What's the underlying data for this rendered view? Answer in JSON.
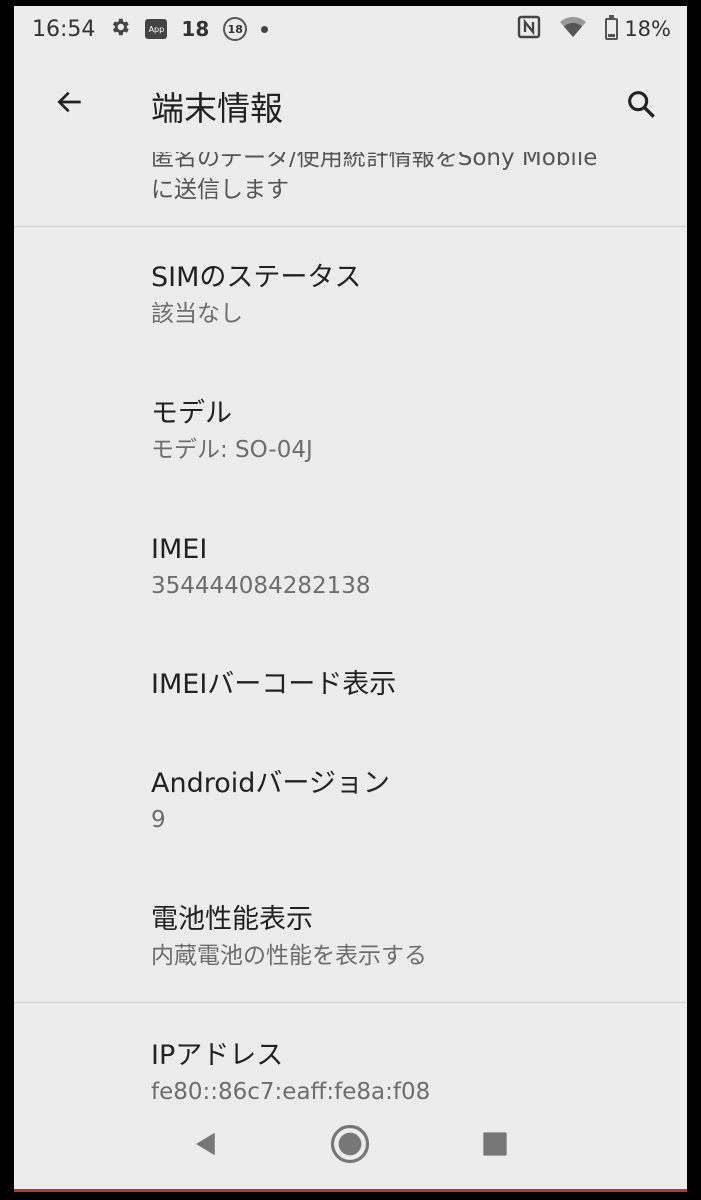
{
  "status_bar": {
    "time": "16:54",
    "notification_count": "18",
    "circle_badge": "18",
    "app_icon_label": "App",
    "battery_percent": "18%",
    "battery_level": 0.18
  },
  "app_bar": {
    "title": "端末情報"
  },
  "list": {
    "partial_item_line1": "匿名のデータ/使用統計情報をSony Mobile",
    "partial_item_line2": "に送信します",
    "items": [
      {
        "title": "SIMのステータス",
        "subtitle": "該当なし"
      },
      {
        "title": "モデル",
        "subtitle": "モデル: SO-04J"
      },
      {
        "title": "IMEI",
        "subtitle": "354444084282138"
      },
      {
        "title": "IMEIバーコード表示",
        "subtitle": ""
      },
      {
        "title": "Androidバージョン",
        "subtitle": "9"
      },
      {
        "title": "電池性能表示",
        "subtitle": "内蔵電池の性能を表示する"
      },
      {
        "title": "IPアドレス",
        "subtitle": "fe80::86c7:eaff:fe8a:f08"
      }
    ]
  },
  "icons": {
    "back": "arrow-back-icon",
    "search": "search-icon",
    "settings": "gear-icon",
    "nfc": "nfc-icon",
    "wifi": "wifi-icon",
    "battery": "battery-icon",
    "nav_back": "triangle-back-icon",
    "nav_home": "circle-home-icon",
    "nav_recents": "square-recents-icon"
  },
  "colors": {
    "background": "#ececec",
    "text_primary": "#222222",
    "text_secondary": "#6d6d6d"
  }
}
